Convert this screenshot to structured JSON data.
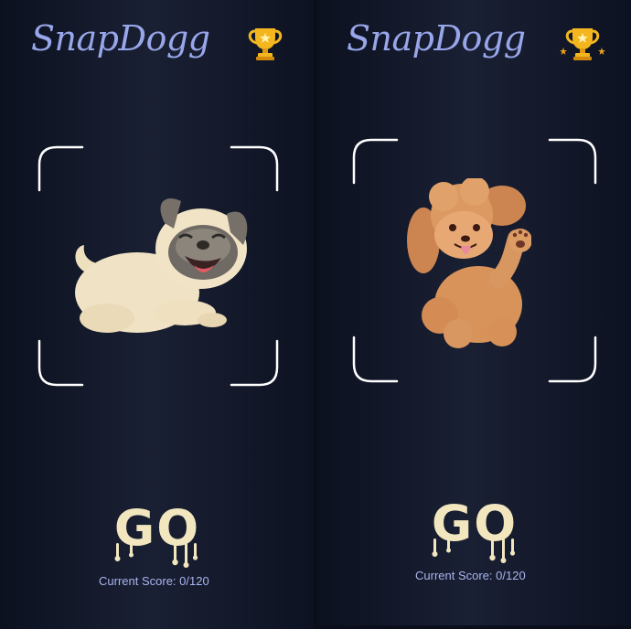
{
  "screens": [
    {
      "app_title": "SnapDogg",
      "trophy_icon": "trophy-icon",
      "dog_icon": "pug-icon",
      "go_label": "GO",
      "score_label": "Current Score: 0/120"
    },
    {
      "app_title": "SnapDogg",
      "trophy_icon": "trophy-with-stars-icon",
      "dog_icon": "poodle-icon",
      "go_label": "GO",
      "score_label": "Current Score: 0/120"
    }
  ],
  "colors": {
    "brand": "#98a6ea",
    "go_text": "#f2e6bf",
    "trophy_gold": "#f3b61f",
    "frame": "#ffffff",
    "score_text": "#a9b4ee"
  }
}
